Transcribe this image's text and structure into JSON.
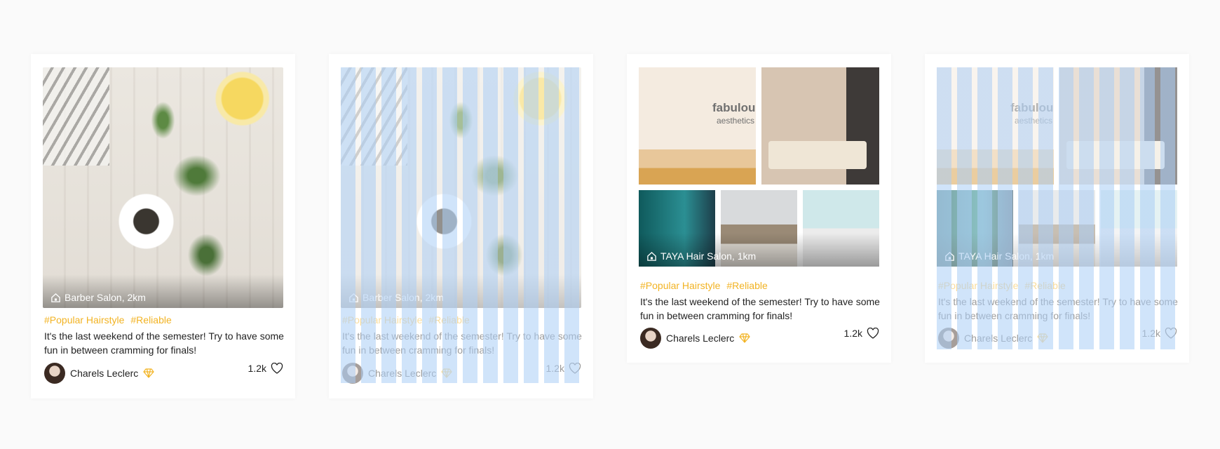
{
  "cards": [
    {
      "location": "Barber Salon, 2km",
      "tags": [
        "#Popular Hairstyle",
        "#Reliable"
      ],
      "description": "It's the last weekend of the semester! Try to have some fun in between cramming for finals!",
      "author": "Charels Leclerc",
      "likes": "1.2k"
    },
    {
      "location": "Barber Salon, 2km",
      "tags": [
        "#Popular Hairstyle",
        "#Reliable"
      ],
      "description": "It's the last weekend of the semester! Try to have some fun in between cramming for finals!",
      "author": "Charels Leclerc",
      "likes": "1.2k"
    },
    {
      "location": "TAYA Hair Salon, 1km",
      "brand": "fabulous",
      "brand_sub": "aesthetics",
      "tags": [
        "#Popular Hairstyle",
        "#Reliable"
      ],
      "description": "It's the last weekend of the semester! Try to have some fun in between cramming for finals!",
      "author": "Charels Leclerc",
      "likes": "1.2k"
    },
    {
      "location": "TAYA Hair Salon, 1km",
      "brand": "fabulous",
      "brand_sub": "aesthetics",
      "tags": [
        "#Popular Hairstyle",
        "#Reliable"
      ],
      "description": "It's the last weekend of the semester! Try to have some fun in between cramming for finals!",
      "author": "Charels Leclerc",
      "likes": "1.2k"
    }
  ],
  "icons": {
    "location": "home-icon",
    "badge": "diamond-icon",
    "like": "heart-icon"
  },
  "colors": {
    "tag": "#f2b323",
    "grid_overlay": "#aacdf5"
  }
}
